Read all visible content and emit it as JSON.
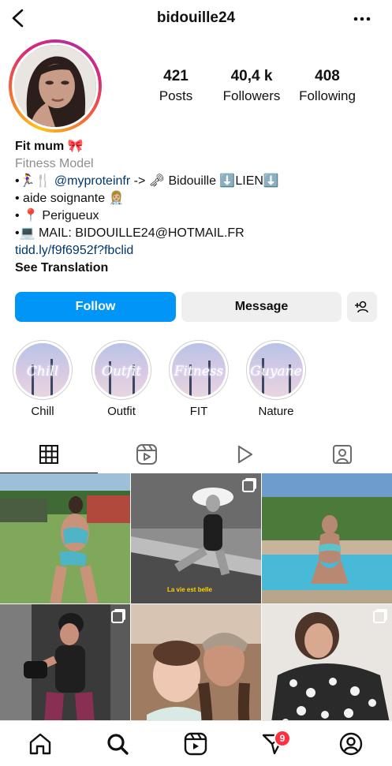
{
  "header": {
    "username": "bidouille24"
  },
  "stats": [
    {
      "value": "421",
      "label": "Posts"
    },
    {
      "value": "40,4 k",
      "label": "Followers"
    },
    {
      "value": "408",
      "label": "Following"
    }
  ],
  "bio": {
    "name": "Fit mum 🎀",
    "category": "Fitness Model",
    "line1_prefix": "•🏃‍♀️🍴",
    "line1_mention": "@myproteinfr",
    "line1_suffix": "-> 🗝 Bidouille ⬇️LIEN⬇️",
    "line2": "• aide soignante 👩🏼‍⚕️",
    "line3": "• 📍 Perigueux",
    "line4": "•💻 MAIL: BIDOUILLE24@HOTMAIL.FR",
    "link": "tidd.ly/f9f6952f?fbclid",
    "see_translation": "See Translation"
  },
  "actions": {
    "follow": "Follow",
    "message": "Message"
  },
  "highlights": [
    {
      "script": "Chill",
      "label": "Chill"
    },
    {
      "script": "Outfit",
      "label": "Outfit"
    },
    {
      "script": "Fitness",
      "label": "FIT"
    },
    {
      "script": "Guyane",
      "label": "Nature"
    }
  ],
  "tabs": [
    "grid-icon",
    "reels-icon",
    "play-icon",
    "tagged-icon"
  ],
  "posts": [
    {
      "caption": ""
    },
    {
      "caption": "La vie est belle"
    },
    {
      "caption": ""
    },
    {
      "caption": ""
    },
    {
      "caption": ""
    },
    {
      "caption": ""
    }
  ],
  "bottom_nav": {
    "messages_badge": "9"
  },
  "colors": {
    "follow_button": "#0095f6",
    "link": "#00376b",
    "badge": "#ff3040"
  }
}
